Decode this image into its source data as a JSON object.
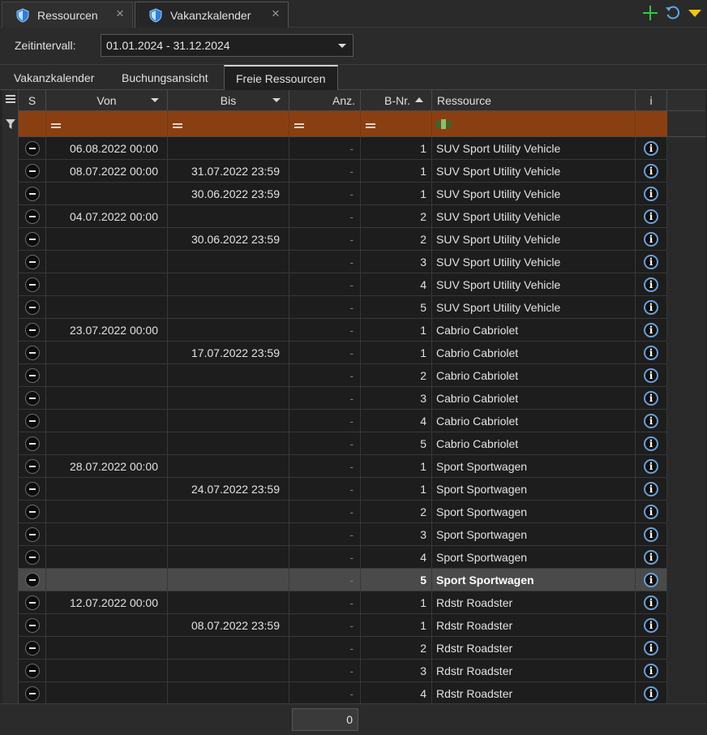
{
  "doc_tabs": [
    {
      "label": "Ressourcen"
    },
    {
      "label": "Vakanzkalender"
    }
  ],
  "colors": {
    "add": "#2ecc40",
    "refresh": "#5fa8e8",
    "menu": "#f0c419",
    "filter_row": "#8a3f12",
    "info": "#6b9fd6"
  },
  "filter": {
    "label": "Zeitintervall:",
    "value": "01.01.2024 - 31.12.2024"
  },
  "view_tabs": [
    {
      "label": "Vakanzkalender"
    },
    {
      "label": "Buchungsansicht"
    },
    {
      "label": "Freie Ressourcen",
      "active": true
    }
  ],
  "columns": {
    "s": "S",
    "von": "Von",
    "bis": "Bis",
    "anz": "Anz.",
    "bnr": "B-Nr.",
    "res": "Ressource",
    "i": "i"
  },
  "filter_row": {
    "abc_icon": "abc-filter-icon",
    "eq_icon": "equals-icon"
  },
  "rows": [
    {
      "von": "06.08.2022 00:00",
      "bis": "",
      "anz": "-",
      "bnr": "1",
      "res": "SUV Sport Utility Vehicle"
    },
    {
      "von": "08.07.2022 00:00",
      "bis": "31.07.2022 23:59",
      "anz": "-",
      "bnr": "1",
      "res": "SUV Sport Utility Vehicle"
    },
    {
      "von": "",
      "bis": "30.06.2022 23:59",
      "anz": "-",
      "bnr": "1",
      "res": "SUV Sport Utility Vehicle"
    },
    {
      "von": "04.07.2022 00:00",
      "bis": "",
      "anz": "-",
      "bnr": "2",
      "res": "SUV Sport Utility Vehicle"
    },
    {
      "von": "",
      "bis": "30.06.2022 23:59",
      "anz": "-",
      "bnr": "2",
      "res": "SUV Sport Utility Vehicle"
    },
    {
      "von": "",
      "bis": "",
      "anz": "-",
      "bnr": "3",
      "res": "SUV Sport Utility Vehicle"
    },
    {
      "von": "",
      "bis": "",
      "anz": "-",
      "bnr": "4",
      "res": "SUV Sport Utility Vehicle"
    },
    {
      "von": "",
      "bis": "",
      "anz": "-",
      "bnr": "5",
      "res": "SUV Sport Utility Vehicle"
    },
    {
      "von": "23.07.2022 00:00",
      "bis": "",
      "anz": "-",
      "bnr": "1",
      "res": "Cabrio Cabriolet"
    },
    {
      "von": "",
      "bis": "17.07.2022 23:59",
      "anz": "-",
      "bnr": "1",
      "res": "Cabrio Cabriolet"
    },
    {
      "von": "",
      "bis": "",
      "anz": "-",
      "bnr": "2",
      "res": "Cabrio Cabriolet"
    },
    {
      "von": "",
      "bis": "",
      "anz": "-",
      "bnr": "3",
      "res": "Cabrio Cabriolet"
    },
    {
      "von": "",
      "bis": "",
      "anz": "-",
      "bnr": "4",
      "res": "Cabrio Cabriolet"
    },
    {
      "von": "",
      "bis": "",
      "anz": "-",
      "bnr": "5",
      "res": "Cabrio Cabriolet"
    },
    {
      "von": "28.07.2022 00:00",
      "bis": "",
      "anz": "-",
      "bnr": "1",
      "res": "Sport Sportwagen"
    },
    {
      "von": "",
      "bis": "24.07.2022 23:59",
      "anz": "-",
      "bnr": "1",
      "res": "Sport Sportwagen"
    },
    {
      "von": "",
      "bis": "",
      "anz": "-",
      "bnr": "2",
      "res": "Sport Sportwagen"
    },
    {
      "von": "",
      "bis": "",
      "anz": "-",
      "bnr": "3",
      "res": "Sport Sportwagen"
    },
    {
      "von": "",
      "bis": "",
      "anz": "-",
      "bnr": "4",
      "res": "Sport Sportwagen"
    },
    {
      "von": "",
      "bis": "",
      "anz": "-",
      "bnr": "5",
      "res": "Sport Sportwagen",
      "selected": true
    },
    {
      "von": "12.07.2022 00:00",
      "bis": "",
      "anz": "-",
      "bnr": "1",
      "res": "Rdstr Roadster"
    },
    {
      "von": "",
      "bis": "08.07.2022 23:59",
      "anz": "-",
      "bnr": "1",
      "res": "Rdstr Roadster"
    },
    {
      "von": "",
      "bis": "",
      "anz": "-",
      "bnr": "2",
      "res": "Rdstr Roadster"
    },
    {
      "von": "",
      "bis": "",
      "anz": "-",
      "bnr": "3",
      "res": "Rdstr Roadster"
    },
    {
      "von": "",
      "bis": "",
      "anz": "-",
      "bnr": "4",
      "res": "Rdstr Roadster"
    }
  ],
  "footer": {
    "sum": "0"
  }
}
